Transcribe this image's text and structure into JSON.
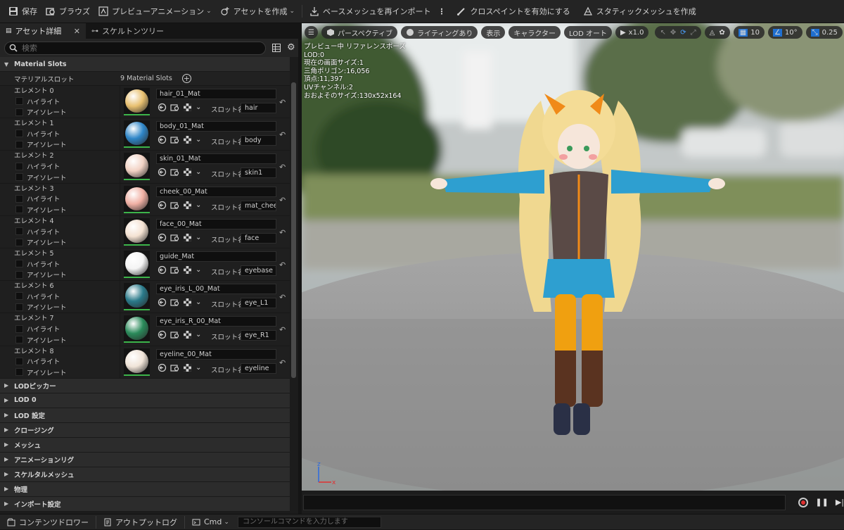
{
  "toolbar": {
    "save": "保存",
    "browse": "ブラウズ",
    "preview_animation": "プレビューアニメーション",
    "create_asset": "アセットを作成",
    "reimport": "ベースメッシュを再インポート",
    "cloth_paint": "クロスペイントを有効にする",
    "make_static": "スタティックメッシュを作成"
  },
  "tabs": [
    {
      "label": "アセット詳細"
    },
    {
      "label": "スケルトンツリー"
    }
  ],
  "search": {
    "placeholder": "検索"
  },
  "material_slots": {
    "category": "Material Slots",
    "header_label": "マテリアルスロット",
    "count": "9 Material Slots",
    "highlight_label": "ハイライト",
    "isolate_label": "アイソレート",
    "slot_name_label": "スロット名",
    "elements": [
      {
        "name": "エレメント 0",
        "material": "hair_01_Mat",
        "slot": "hair",
        "color": "#e8c070"
      },
      {
        "name": "エレメント 1",
        "material": "body_01_Mat",
        "slot": "body",
        "color": "#2f86c8"
      },
      {
        "name": "エレメント 2",
        "material": "skin_01_Mat",
        "slot": "skin1",
        "color": "#f2d2c4"
      },
      {
        "name": "エレメント 3",
        "material": "cheek_00_Mat",
        "slot": "mat_cheek",
        "color": "#f0b0a4"
      },
      {
        "name": "エレメント 4",
        "material": "face_00_Mat",
        "slot": "face",
        "color": "#f4e2d2"
      },
      {
        "name": "エレメント 5",
        "material": "guide_Mat",
        "slot": "eyebase",
        "color": "#f4f4f4"
      },
      {
        "name": "エレメント 6",
        "material": "eye_iris_L_00_Mat",
        "slot": "eye_L1",
        "color": "#2a7a8a"
      },
      {
        "name": "エレメント 7",
        "material": "eye_iris_R_00_Mat",
        "slot": "eye_R1",
        "color": "#2a8a5a"
      },
      {
        "name": "エレメント 8",
        "material": "eyeline_00_Mat",
        "slot": "eyeline",
        "color": "#f0e4d8"
      }
    ]
  },
  "categories": [
    {
      "label": "LODピッカー"
    },
    {
      "label": "LOD 0"
    },
    {
      "label": "LOD 設定"
    },
    {
      "label": "クロージング"
    },
    {
      "label": "メッシュ"
    },
    {
      "label": "アニメーションリグ"
    },
    {
      "label": "スケルタルメッシュ"
    },
    {
      "label": "物理"
    },
    {
      "label": "インポート設定"
    }
  ],
  "viewport": {
    "perspective": "パースペクティブ",
    "lighting": "ライティングあり",
    "show": "表示",
    "character": "キャラクター",
    "lod": "LOD オート",
    "play_rate": "x1.0",
    "grid_snap": "10",
    "rotation_snap": "10°",
    "scale_snap": "0.25",
    "stats": [
      "プレビュー中 リファレンスポーズ",
      "LOD:0",
      "現在の画面サイズ:1",
      "三角ポリゴン:16,056",
      "頂点:11,397",
      "UVチャンネル:2",
      "おおよそのサイズ:130x52x164"
    ],
    "axis_z": "z",
    "axis_x": "x"
  },
  "statusbar": {
    "content_drawer": "コンテンツドロワー",
    "output_log": "アウトプットログ",
    "cmd": "Cmd",
    "console_placeholder": "コンソールコマンドを入力します"
  }
}
